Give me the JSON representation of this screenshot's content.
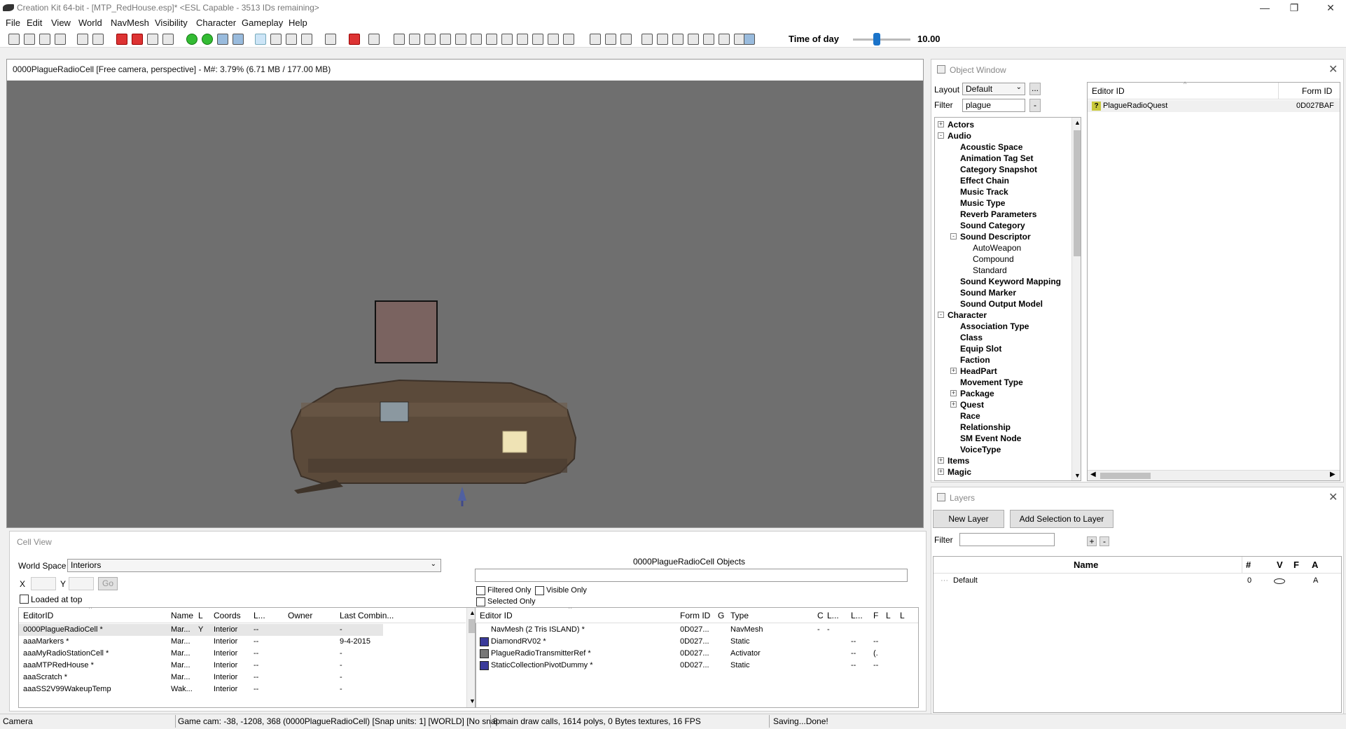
{
  "window": {
    "title": "Creation Kit 64-bit - [MTP_RedHouse.esp]* <ESL Capable - 3513 IDs remaining>",
    "min_glyph": "—",
    "max_glyph": "❐",
    "close_glyph": "✕"
  },
  "menu": [
    "File",
    "Edit",
    "View",
    "World",
    "NavMesh",
    "Visibility",
    "Character",
    "Gameplay",
    "Help"
  ],
  "toolbar": {
    "time_of_day_label": "Time of day",
    "time_of_day_value": "10.00",
    "time_of_day_fraction": 0.42
  },
  "render": {
    "title": "0000PlagueRadioCell [Free camera, perspective] - M#: 3.79% (6.71 MB / 177.00 MB)"
  },
  "object_window": {
    "title": "Object Window",
    "layout_label": "Layout",
    "layout_value": "Default",
    "layout_more": "...",
    "filter_label": "Filter",
    "filter_value": "plague",
    "filter_btn": "-",
    "tree": [
      {
        "label": "Actors",
        "level": 0,
        "exp": "+"
      },
      {
        "label": "Audio",
        "level": 0,
        "exp": "-"
      },
      {
        "label": "Acoustic Space",
        "level": 1
      },
      {
        "label": "Animation Tag Set",
        "level": 1
      },
      {
        "label": "Category Snapshot",
        "level": 1
      },
      {
        "label": "Effect Chain",
        "level": 1
      },
      {
        "label": "Music Track",
        "level": 1
      },
      {
        "label": "Music Type",
        "level": 1
      },
      {
        "label": "Reverb Parameters",
        "level": 1
      },
      {
        "label": "Sound Category",
        "level": 1
      },
      {
        "label": "Sound Descriptor",
        "level": 1,
        "exp": "-"
      },
      {
        "label": "AutoWeapon",
        "level": 2
      },
      {
        "label": "Compound",
        "level": 2
      },
      {
        "label": "Standard",
        "level": 2
      },
      {
        "label": "Sound Keyword Mapping",
        "level": 1
      },
      {
        "label": "Sound Marker",
        "level": 1
      },
      {
        "label": "Sound Output Model",
        "level": 1
      },
      {
        "label": "Character",
        "level": 0,
        "exp": "-"
      },
      {
        "label": "Association Type",
        "level": 1
      },
      {
        "label": "Class",
        "level": 1
      },
      {
        "label": "Equip Slot",
        "level": 1
      },
      {
        "label": "Faction",
        "level": 1
      },
      {
        "label": "HeadPart",
        "level": 1,
        "exp": "+"
      },
      {
        "label": "Movement Type",
        "level": 1
      },
      {
        "label": "Package",
        "level": 1,
        "exp": "+"
      },
      {
        "label": "Quest",
        "level": 1,
        "exp": "+"
      },
      {
        "label": "Race",
        "level": 1
      },
      {
        "label": "Relationship",
        "level": 1
      },
      {
        "label": "SM Event Node",
        "level": 1
      },
      {
        "label": "VoiceType",
        "level": 1
      },
      {
        "label": "Items",
        "level": 0,
        "exp": "+"
      },
      {
        "label": "Magic",
        "level": 0,
        "exp": "+"
      }
    ],
    "columns": [
      "Editor ID",
      "Form ID"
    ],
    "rows": [
      {
        "editor_id": "PlagueRadioQuest",
        "form_id": "0D027BAF",
        "icon": "?"
      }
    ]
  },
  "layers": {
    "title": "Layers",
    "new_layer": "New Layer",
    "add_selection": "Add Selection to Layer",
    "filter_label": "Filter",
    "plus": "+",
    "minus": "-",
    "columns": [
      "Name",
      "#",
      "V",
      "F",
      "A"
    ],
    "rows": [
      {
        "name": "Default",
        "count": "0",
        "a": "A"
      }
    ]
  },
  "cell_view": {
    "title": "Cell View",
    "world_space_label": "World Space",
    "world_space_value": "Interiors",
    "x_label": "X",
    "y_label": "Y",
    "go_label": "Go",
    "loaded_at_top": "Loaded at top",
    "columns": [
      "EditorID",
      "Name",
      "L",
      "Coords",
      "L...",
      "Owner",
      "Last Combin..."
    ],
    "rows": [
      [
        "0000PlagueRadioCell *",
        "Mar...",
        "Y",
        "Interior",
        "--",
        "",
        "-"
      ],
      [
        "aaaMarkers *",
        "Mar...",
        "",
        "Interior",
        "--",
        "",
        "9-4-2015"
      ],
      [
        "aaaMyRadioStationCell *",
        "Mar...",
        "",
        "Interior",
        "--",
        "",
        "-"
      ],
      [
        "aaaMTPRedHouse *",
        "Mar...",
        "",
        "Interior",
        "--",
        "",
        "-"
      ],
      [
        "aaaScratch *",
        "Mar...",
        "",
        "Interior",
        "--",
        "",
        "-"
      ],
      [
        "aaaSS2V99WakeupTemp",
        "Wak...",
        "",
        "Interior",
        "--",
        "",
        "-"
      ]
    ],
    "objects_title": "0000PlagueRadioCell Objects",
    "filtered_only": "Filtered Only",
    "visible_only": "Visible Only",
    "selected_only": "Selected Only",
    "obj_columns": [
      "Editor ID",
      "Form ID",
      "G",
      "Type",
      "C",
      "L...",
      "L...",
      "F",
      "L",
      "L"
    ],
    "obj_rows": [
      [
        "NavMesh  (2 Tris ISLAND)  *",
        "0D027...",
        "",
        "NavMesh",
        "-",
        "-",
        "",
        "",
        ""
      ],
      [
        "DiamondRV02 *",
        "0D027...",
        "",
        "Static",
        "",
        "",
        "--",
        "--",
        ""
      ],
      [
        "PlagueRadioTransmitterRef *",
        "0D027...",
        "",
        "Activator",
        "",
        "",
        "--",
        "(.",
        ""
      ],
      [
        "StaticCollectionPivotDummy *",
        "0D027...",
        "",
        "Static",
        "",
        "",
        "--",
        "--",
        ""
      ]
    ]
  },
  "status": {
    "mode": "Camera",
    "game_cam": "Game cam: -38, -1208, 368 (0000PlagueRadioCell) [Snap units: 1] [WORLD] [No snap",
    "draw_stats": "8 main draw calls, 1614 polys, 0 Bytes textures, 16 FPS",
    "message": "Saving...Done!"
  },
  "colors": {
    "accent": "#1a73c9",
    "viewport": "#6f6f6f"
  }
}
